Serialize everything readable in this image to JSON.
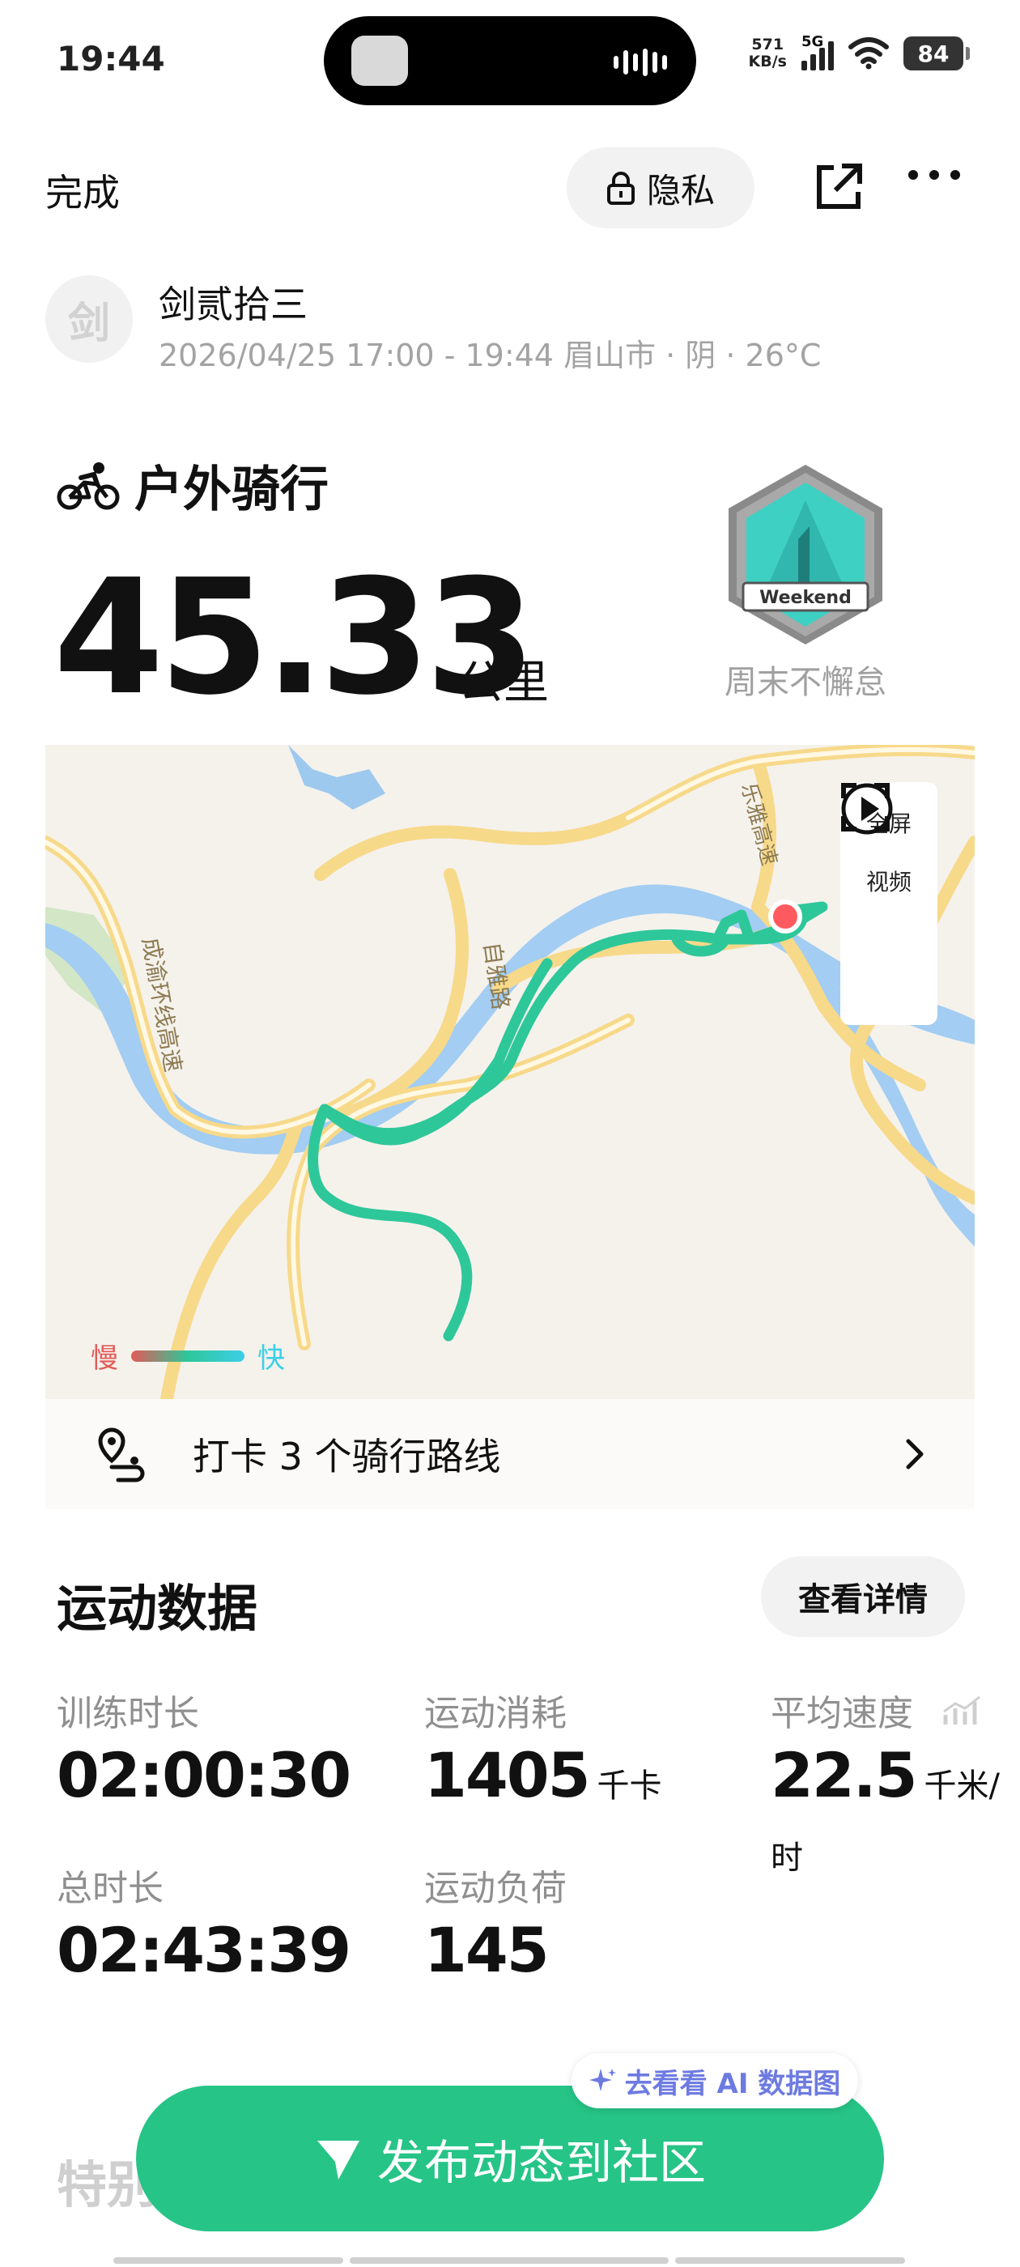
{
  "status_bar": {
    "time": "19:44",
    "net_speed_value": "571",
    "net_speed_unit": "KB/s",
    "network": "5G",
    "battery": "84"
  },
  "nav": {
    "done": "完成",
    "privacy": "隐私",
    "share_icon": "share-external-icon",
    "more_icon": "more-dots-icon"
  },
  "user": {
    "avatar_text": "剑",
    "name": "剑贰拾三",
    "meta": "2026/04/25 17:00 - 19:44 眉山市 · 阴 · 26°C"
  },
  "activity": {
    "type": "户外骑行",
    "distance": "45.33",
    "distance_unit": "公里",
    "badge_text": "Weekend",
    "badge_label": "周末不懈怠"
  },
  "map": {
    "fullscreen": "全屏",
    "video": "视频",
    "legend_slow": "慢",
    "legend_fast": "快",
    "road_labels": [
      "成渝环线高速",
      "自雅路",
      "乐雅高速"
    ],
    "checkin": "打卡 3 个骑行路线"
  },
  "stats": {
    "title": "运动数据",
    "details_button": "查看详情",
    "items": [
      {
        "label": "训练时长",
        "value": "02:00:30",
        "unit": ""
      },
      {
        "label": "运动消耗",
        "value": "1405",
        "unit": "千卡"
      },
      {
        "label": "平均速度",
        "value": "22.5",
        "unit": "千米/时"
      },
      {
        "label": "总时长",
        "value": "02:43:39",
        "unit": ""
      },
      {
        "label": "运动负荷",
        "value": "145",
        "unit": ""
      }
    ]
  },
  "bottom": {
    "ai_chip": "去看看 AI 数据图",
    "section_partial": "特别",
    "publish": "发布动态到社区"
  },
  "colors": {
    "accent": "#26c487",
    "route": "#2ec79a",
    "slow": "#e25a58",
    "fast": "#3ccfe8"
  }
}
